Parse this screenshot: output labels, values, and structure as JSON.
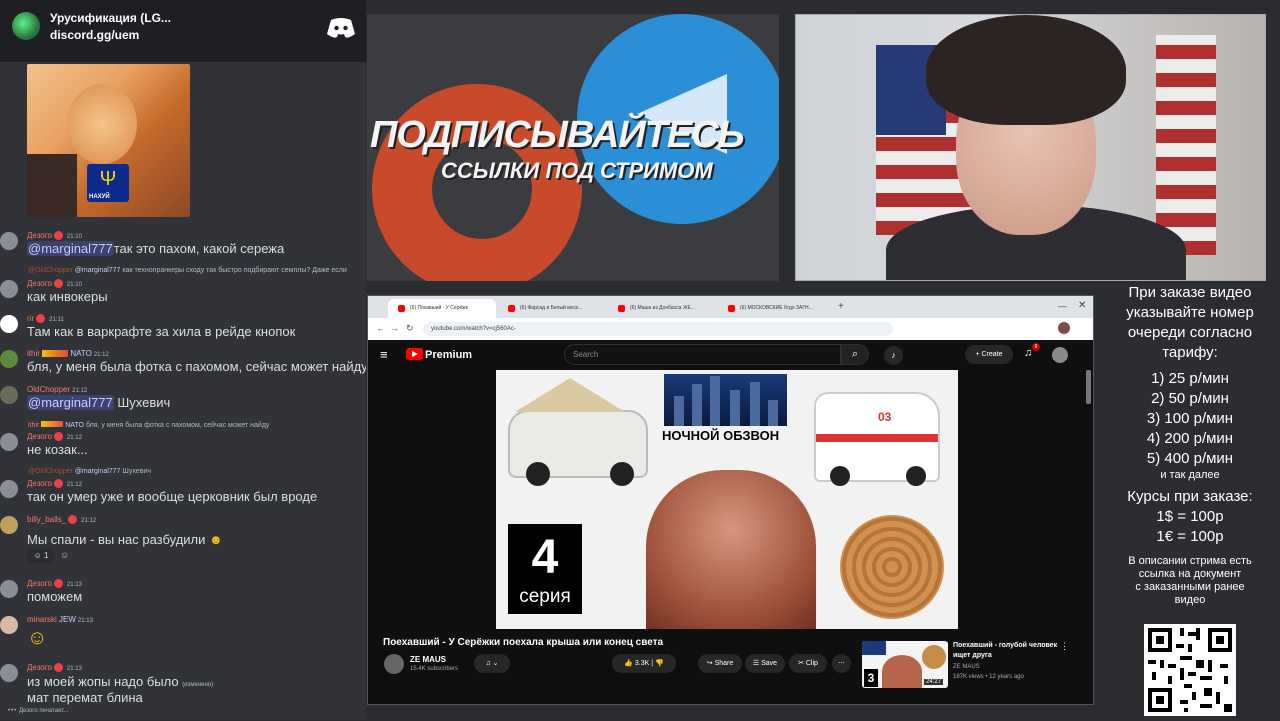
{
  "discord": {
    "server_name": "Урусификация (LG...",
    "invite": "discord.gg/uem",
    "typing": "Дезого печатает..."
  },
  "cat_image": {
    "label": "НАХУЙ"
  },
  "messages": [
    {
      "user": "Дезого",
      "time": "21:10",
      "text": "так это пахом, какой сережа",
      "mention": "@marginal777"
    },
    {
      "user": "Дезого",
      "time": "21:10",
      "text": "как инвокеры",
      "reply": {
        "user": "@OldChopper",
        "mention": "@marginal777",
        "text": "как технопранкеры сходу так быстро подбирают семплы? Даже если"
      }
    },
    {
      "user": "rir",
      "time": "21:11",
      "text": "Там как в варкрафте за хила в рейде кнопок"
    },
    {
      "user": "ithir",
      "tag": "NATO",
      "time": "21:12",
      "text": "бля, у меня была фотка с пахомом, сейчас может найду"
    },
    {
      "user": "OldChopper",
      "time": "21:12",
      "text": "Шухевич",
      "mention": "@marginal777"
    },
    {
      "user": "Дезого",
      "time": "21:12",
      "text": "не козак...",
      "reply": {
        "user": "ithir",
        "tag": "NATO",
        "text": "бля, у меня была фотка с пахомом, сейчас может найду"
      }
    },
    {
      "user": "Дезого",
      "time": "21:12",
      "text": "так он умер  уже и вообще церковник был вроде",
      "reply": {
        "user": "@OldChopper",
        "mention": "@marginal777",
        "text": "Шухевич"
      }
    },
    {
      "user": "billy_balls_",
      "time": "21:12",
      "text": "Мы спали - вы нас разбудили",
      "reaction": "1"
    },
    {
      "user": "Дезого",
      "time": "21:13",
      "text": "поможем"
    },
    {
      "user": "minarski",
      "tag": "JEW",
      "time": "21:13",
      "text": ""
    },
    {
      "user": "Дезого",
      "time": "21:13",
      "text": "из моей жопы надо было",
      "edited": "(изменено)",
      "text2": "мат перемат блина"
    }
  ],
  "promo": {
    "line1": "ПОДПИСЫВАЙТЕСЬ",
    "line2": "ССЫЛКИ ПОД СТРИМОМ"
  },
  "browser": {
    "tabs": [
      "(6) Похавший · У Серёжк",
      "(6) Фарсад и Белый моск...",
      "(6) Маша из Донбасса ЖЕ...",
      "(6) МОСКОВСКИЕ бтдо ЗАГН..."
    ],
    "url": "youtube.com/watch?v=cj560Ac-"
  },
  "youtube": {
    "brand": "Premium",
    "search_placeholder": "Search",
    "create": "Create",
    "notif_count": "9",
    "thumb_caption": "НОЧНОЙ ОБЗВОН",
    "thumb_number": "4",
    "thumb_series": "серия",
    "thumb_amb": "03",
    "title": "Поехавший - У Серёжки поехала крыша или конец света",
    "channel": "ZE MAUS",
    "subs": "15.4K subscribers",
    "likes": "3.3K",
    "share": "Share",
    "save": "Save",
    "clip": "Clip",
    "side_title": "Поехавший - голубой человек ищет друга",
    "side_channel": "ZE MAUS",
    "side_meta": "187K views • 12 years ago",
    "side_duration": "24:27",
    "side_num": "3"
  },
  "info": {
    "head": [
      "При заказе видео",
      "указывайте номер",
      "очереди согласно",
      "тарифу:"
    ],
    "tariffs": [
      "1) 25 р/мин",
      "2) 50 р/мин",
      "3) 100 р/мин",
      "4) 200 р/мин",
      "5) 400 р/мин"
    ],
    "etc": "и так далее",
    "rates_head": "Курсы при заказе:",
    "rates": [
      "1$ = 100р",
      "1€ = 100р"
    ],
    "desc": [
      "В описании стрима есть",
      "ссылка на документ",
      "с заказанными ранее",
      "видео"
    ]
  },
  "colors": {
    "discord_bg": "#313338",
    "mention_bg": "#3c4270",
    "yt_red": "#ff0000",
    "badge_red": "#ed4245"
  }
}
